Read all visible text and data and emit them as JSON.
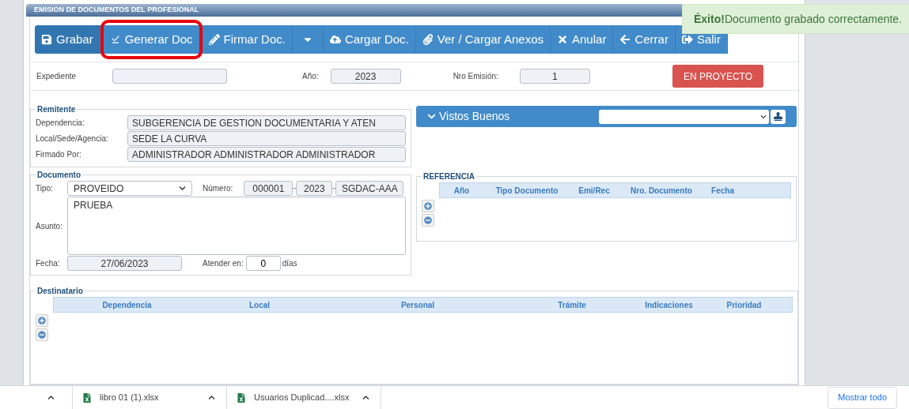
{
  "panel": {
    "title": "EMISION DE DOCUMENTOS DEL PROFESIONAL"
  },
  "toolbar": [
    {
      "label": "Grabar",
      "highlighted": false
    },
    {
      "label": "Generar Doc",
      "highlighted": true
    },
    {
      "label": "Firmar Doc.",
      "highlighted": false
    },
    {
      "kind": "dropdown",
      "highlighted": false
    },
    {
      "label": "Cargar Doc.",
      "highlighted": false
    },
    {
      "label": "Ver / Cargar Anexos",
      "highlighted": false
    },
    {
      "label": "Anular",
      "highlighted": false
    },
    {
      "label": "Cerrar",
      "highlighted": false
    },
    {
      "label": "Salir",
      "highlighted": false
    }
  ],
  "header_row": {
    "expediente_label": "Expediente",
    "anio_label": "Año:",
    "anio_value": "2023",
    "nro_label": "Nro Emisión:",
    "nro_value": "1",
    "status": "EN PROYECTO"
  },
  "remitente": {
    "legend": "Remitente",
    "fields": [
      {
        "label": "Dependencia:",
        "value": "SUBGERENCIA DE GESTION DOCUMENTARIA Y ATEN"
      },
      {
        "label": "Local/Sede/Agencia:",
        "value": "SEDE LA CURVA"
      },
      {
        "label": "Firmado Por:",
        "value": "ADMINISTRADOR ADMINISTRADOR ADMINISTRADOR"
      }
    ]
  },
  "documento": {
    "legend": "Documento",
    "tipo_label": "Tipo:",
    "tipo_value": "PROVEIDO",
    "numero_label": "Número:",
    "numero_parts": [
      "000001",
      "2023",
      "SGDAC-AAA"
    ],
    "asunto_label": "Asunto:",
    "asunto_value": "PRUEBA",
    "fecha_label": "Fecha:",
    "fecha_value": "27/06/2023",
    "atender_label": "Atender en:",
    "atender_value": "0",
    "dias_label": "días"
  },
  "vistos_buenos": {
    "title": "Vistos Buenos"
  },
  "referencia": {
    "legend": "REFERENCIA",
    "columns": [
      "Año",
      "Tipo Documento",
      "Emi/Rec",
      "Nro. Documento",
      "Fecha"
    ]
  },
  "destinatario": {
    "legend": "Destinatario",
    "columns": [
      "Dependencia",
      "Local",
      "Personal",
      "Trámite",
      "Indicaciones",
      "Prioridad"
    ]
  },
  "toast": {
    "title": "Éxito!",
    "message": "Documento grabado correctamente."
  },
  "downloads": {
    "files": [
      "libro 01 (1).xlsx",
      "Usuarios Duplicad....xlsx"
    ],
    "show_all": "Mostrar todo"
  }
}
